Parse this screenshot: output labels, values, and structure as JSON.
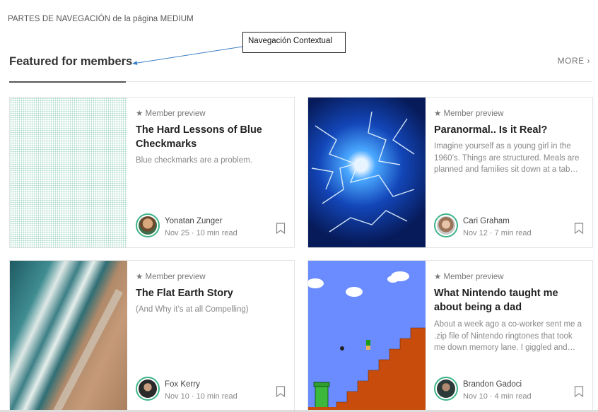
{
  "caption": "PARTES DE NAVEGACIÓN de la página MEDIUM",
  "callout": "Navegación Contextual",
  "section": {
    "title": "Featured for members",
    "more": "MORE"
  },
  "cards": [
    {
      "badge": "Member preview",
      "title": "The Hard Lessons of Blue Checkmarks",
      "description": "Blue checkmarks are a problem.",
      "author": "Yonatan Zunger",
      "meta": "Nov 25 · 10 min read",
      "thumb": "dots-pattern"
    },
    {
      "badge": "Member preview",
      "title": "Paranormal.. Is it Real?",
      "description": "Imagine yourself as a young girl in the 1960’s. Things are structured. Meals are planned and families sit down at a tab…",
      "author": "Cari Graham",
      "meta": "Nov 12 · 7 min read",
      "thumb": "blue-lightning"
    },
    {
      "badge": "Member preview",
      "title": "The Flat Earth Story",
      "description": "(And Why it’s at all Compelling)",
      "author": "Fox Kerry",
      "meta": "Nov 10 · 10 min read",
      "thumb": "coastline-aerial"
    },
    {
      "badge": "Member preview",
      "title": "What Nintendo taught me about being a dad",
      "description": "About a week ago a co-worker sent me a .zip file of Nintendo ringtones that took me down memory lane. I giggled and…",
      "author": "Brandon Gadoci",
      "meta": "Nov 10 · 4 min read",
      "thumb": "mario-level"
    }
  ],
  "colors": {
    "accent": "#3eb488",
    "arrow": "#3b7fc4"
  }
}
